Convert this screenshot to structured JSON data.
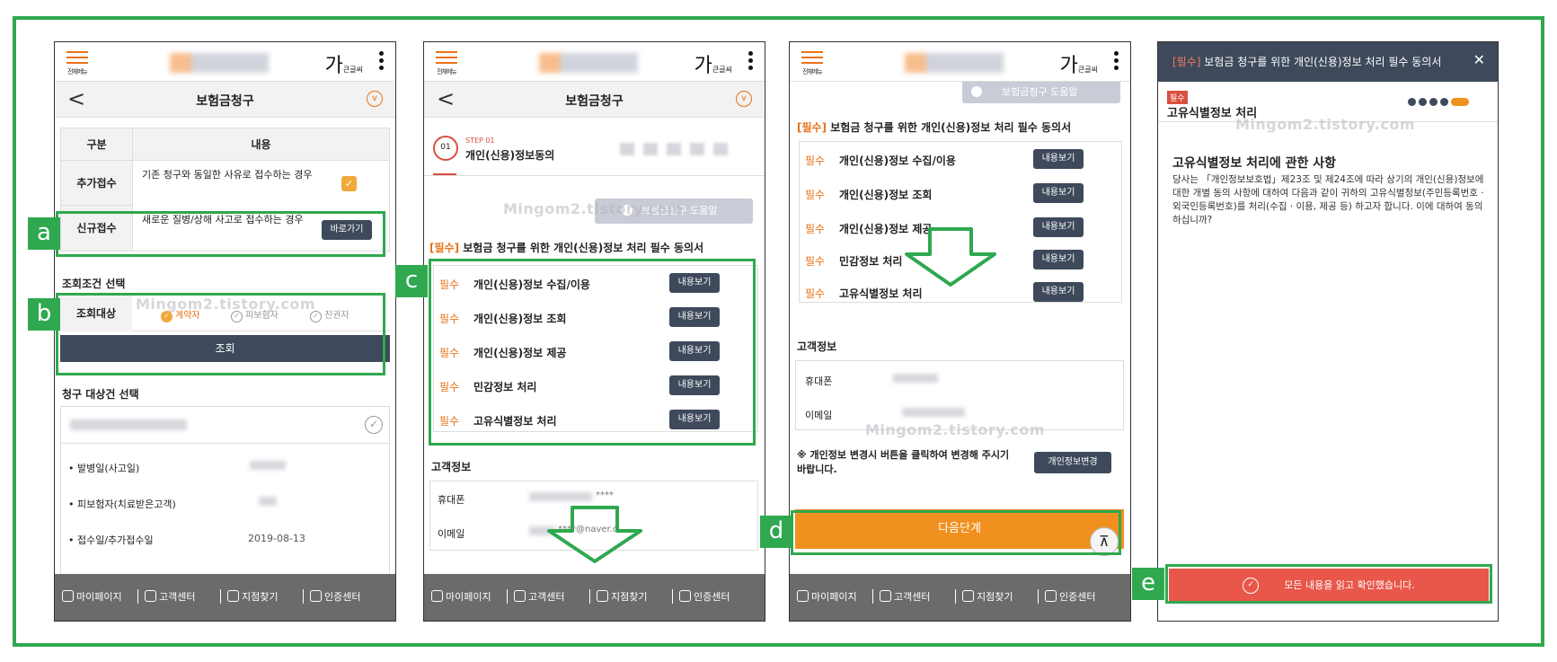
{
  "common": {
    "menu_label": "전체메뉴",
    "font_size_glyph": "가",
    "font_size_label": "큰글씨",
    "nav_title": "보험금청구",
    "back_glyph": "<",
    "down_glyph": "v",
    "watermark": "Mingom2.tistory.com",
    "bottom_nav": [
      "마이페이지",
      "고객센터",
      "지점찾기",
      "인증센터"
    ],
    "accent_color": "#e8731a",
    "highlight_color": "#2fa84f"
  },
  "screen1": {
    "table_headers": [
      "구분",
      "내용"
    ],
    "rows": [
      {
        "label": "추가접수",
        "desc": "기존 청구와 동일한 사유로 접수하는 경우"
      },
      {
        "label": "신규접수",
        "desc": "새로운 질병/상해 사고로 접수하는 경우",
        "button": "바로가기"
      }
    ],
    "query_section": "조회조건 선택",
    "query_label": "조회대상",
    "query_options": [
      "계약자",
      "피보험자",
      "친권자"
    ],
    "query_button": "조회",
    "claim_section": "청구 대상건 선택",
    "claim_fields": [
      {
        "label": "• 발병일(사고일)",
        "value": ""
      },
      {
        "label": "• 피보험자(치료받은고객)",
        "value": ""
      },
      {
        "label": "• 접수일/추가접수일",
        "value": "2019-08-13"
      }
    ]
  },
  "screen2": {
    "step_label": "STEP 01",
    "step_number": "01",
    "step_title": "개인(신용)정보동의",
    "help_button": "보험금청구 도움말",
    "consent_prefix": "[필수]",
    "consent_title": " 보험금 청구를 위한 개인(신용)정보 처리 필수 동의서",
    "consent_tag": "필수",
    "consent_items": [
      "개인(신용)정보 수집/이용",
      "개인(신용)정보 조회",
      "개인(신용)정보 제공",
      "민감정보 처리",
      "고유식별정보 처리"
    ],
    "view_button": "내용보기",
    "customer_section": "고객정보",
    "phone_label": "휴대폰",
    "phone_value": "****",
    "email_label": "이메일",
    "email_value": "****@naver.c"
  },
  "screen3": {
    "help_button": "보험금청구 도움말",
    "customer_section": "고객정보",
    "phone_label": "휴대폰",
    "email_label": "이메일",
    "notice": "※ 개인정보 변경시 버튼을 클릭하여 변경해 주시기 바랍니다.",
    "change_button": "개인정보변경",
    "next_button": "다음단계",
    "top_glyph": "⊼"
  },
  "screen4": {
    "header_prefix": "[필수]",
    "header_title": " 보험금 청구를 위한 개인(신용)정보 처리 필수 동의서",
    "close_glyph": "✕",
    "tag": "필수",
    "subtitle": "고유식별정보 처리",
    "body_title": "고유식별정보 처리에 관한 사항",
    "body_text": "당사는 「개인정보보호법」제23조 및 제24조에 따라 상기의 개인(신용)정보에 대한 개별 동의 사항에 대하여 다음과 같이 귀하의 고유식별정보(주민등록번호 · 외국인등록번호)를 처리(수집 · 이용, 제공 등) 하고자 합니다. 이에 대하여 동의하십니까?",
    "confirm_button": "모든 내용을 읽고 확인했습니다.",
    "confirm_color": "#e8574a"
  },
  "callouts": [
    "a",
    "b",
    "c",
    "d",
    "e"
  ]
}
